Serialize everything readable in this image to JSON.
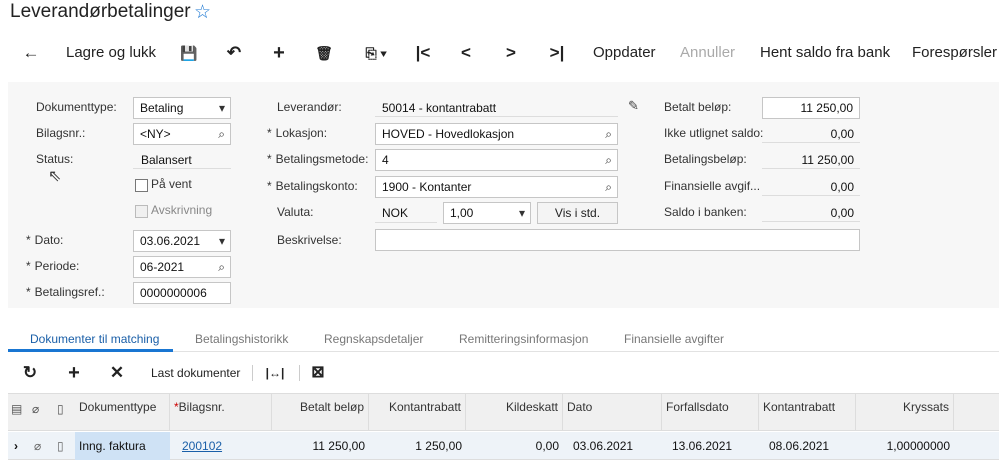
{
  "header": {
    "title": "Leverandørbetalinger",
    "star_icon": "star-outline-icon"
  },
  "toolbar": {
    "back_icon": "←",
    "save_close": "Lagre og lukk",
    "save_icon": "💾",
    "undo_icon": "↶",
    "add_icon": "+",
    "delete_icon": "🗑",
    "copy_icon": "⎘ ▾",
    "first_icon": "|<",
    "prev_icon": "<",
    "next_icon": ">",
    "last_icon": ">|",
    "update": "Oppdater",
    "cancel": "Annuller",
    "get_balance": "Hent saldo fra bank",
    "inquiries": "Forespørsler"
  },
  "form": {
    "doc_type_label": "Dokumenttype:",
    "doc_type_value": "Betaling",
    "voucher_label": "Bilagsnr.:",
    "voucher_value": "<NY>",
    "status_label": "Status:",
    "status_value": "Balansert",
    "on_hold_label": "På vent",
    "writeoff_label": "Avskrivning",
    "date_label": "Dato:",
    "date_value": "03.06.2021",
    "period_label": "Periode:",
    "period_value": "06-2021",
    "payref_label": "Betalingsref.:",
    "payref_value": "0000000006",
    "vendor_label": "Leverandør:",
    "vendor_value": "50014 - kontantrabatt",
    "location_label": "Lokasjon:",
    "location_value": "HOVED - Hovedlokasjon",
    "paymethod_label": "Betalingsmetode:",
    "paymethod_value": "4",
    "payaccount_label": "Betalingskonto:",
    "payaccount_value": "1900 - Kontanter",
    "currency_label": "Valuta:",
    "currency_code": "NOK",
    "currency_rate": "1,00",
    "view_std": "Vis i std.",
    "description_label": "Beskrivelse:",
    "description_value": "",
    "paid_amount_label": "Betalt beløp:",
    "paid_amount_value": "11 250,00",
    "unapplied_label": "Ikke utlignet saldo:",
    "unapplied_value": "0,00",
    "payment_amount_label": "Betalingsbeløp:",
    "payment_amount_value": "11 250,00",
    "fin_charges_label": "Finansielle avgif...",
    "fin_charges_value": "0,00",
    "bank_balance_label": "Saldo i banken:",
    "bank_balance_value": "0,00",
    "required_mark": "*"
  },
  "tabs": [
    {
      "label": "Dokumenter til matching"
    },
    {
      "label": "Betalingshistorikk"
    },
    {
      "label": "Regnskapsdetaljer"
    },
    {
      "label": "Remitteringsinformasjon"
    },
    {
      "label": "Finansielle avgifter"
    }
  ],
  "grid_toolbar": {
    "refresh_icon": "↻",
    "add_icon": "+",
    "delete_icon": "✕",
    "load_docs": "Last dokumenter",
    "fit_icon": "|↔|",
    "export_icon": "⊠"
  },
  "grid": {
    "columns": [
      "Dokumenttype",
      "Bilagsnr.",
      "Betalt beløp",
      "Kontantrabatt",
      "Kildeskatt",
      "Dato",
      "Forfallsdato",
      "Kontantrabatt",
      "Kryssats"
    ],
    "rows": [
      {
        "doc_type": "Inng. faktura",
        "voucher": "200102",
        "paid": "11 250,00",
        "discount": "1 250,00",
        "withholding": "0,00",
        "date": "03.06.2021",
        "due_date": "13.06.2021",
        "discount_date": "08.06.2021",
        "cross_rate": "1,00000000"
      }
    ]
  }
}
